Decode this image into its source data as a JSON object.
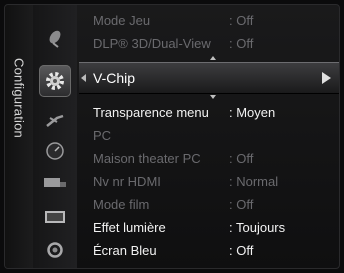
{
  "side": {
    "title": "Configuration"
  },
  "icons": [
    {
      "name": "satellite-dish-icon"
    },
    {
      "name": "settings-gear-icon"
    },
    {
      "name": "input-antenna-icon"
    },
    {
      "name": "clock-icon"
    },
    {
      "name": "remote-control-icon"
    },
    {
      "name": "screen-icon"
    },
    {
      "name": "support-icon"
    }
  ],
  "menu": {
    "items": [
      {
        "label": "Mode Jeu",
        "value": ": Off",
        "state": "disabled"
      },
      {
        "label": "DLP® 3D/Dual-View",
        "value": ": Off",
        "state": "disabled"
      },
      {
        "label": "V-Chip",
        "value": "",
        "state": "selected"
      },
      {
        "label": "Transparence menu",
        "value": ": Moyen",
        "state": "enabled"
      },
      {
        "label": "PC",
        "value": "",
        "state": "disabled"
      },
      {
        "label": "Maison theater PC",
        "value": ": Off",
        "state": "disabled"
      },
      {
        "label": "Nv nr HDMI",
        "value": ": Normal",
        "state": "disabled"
      },
      {
        "label": "Mode film",
        "value": ": Off",
        "state": "disabled"
      },
      {
        "label": "Effet lumière",
        "value": ": Toujours",
        "state": "enabled"
      },
      {
        "label": "Écran Bleu",
        "value": ": Off",
        "state": "enabled"
      }
    ]
  }
}
